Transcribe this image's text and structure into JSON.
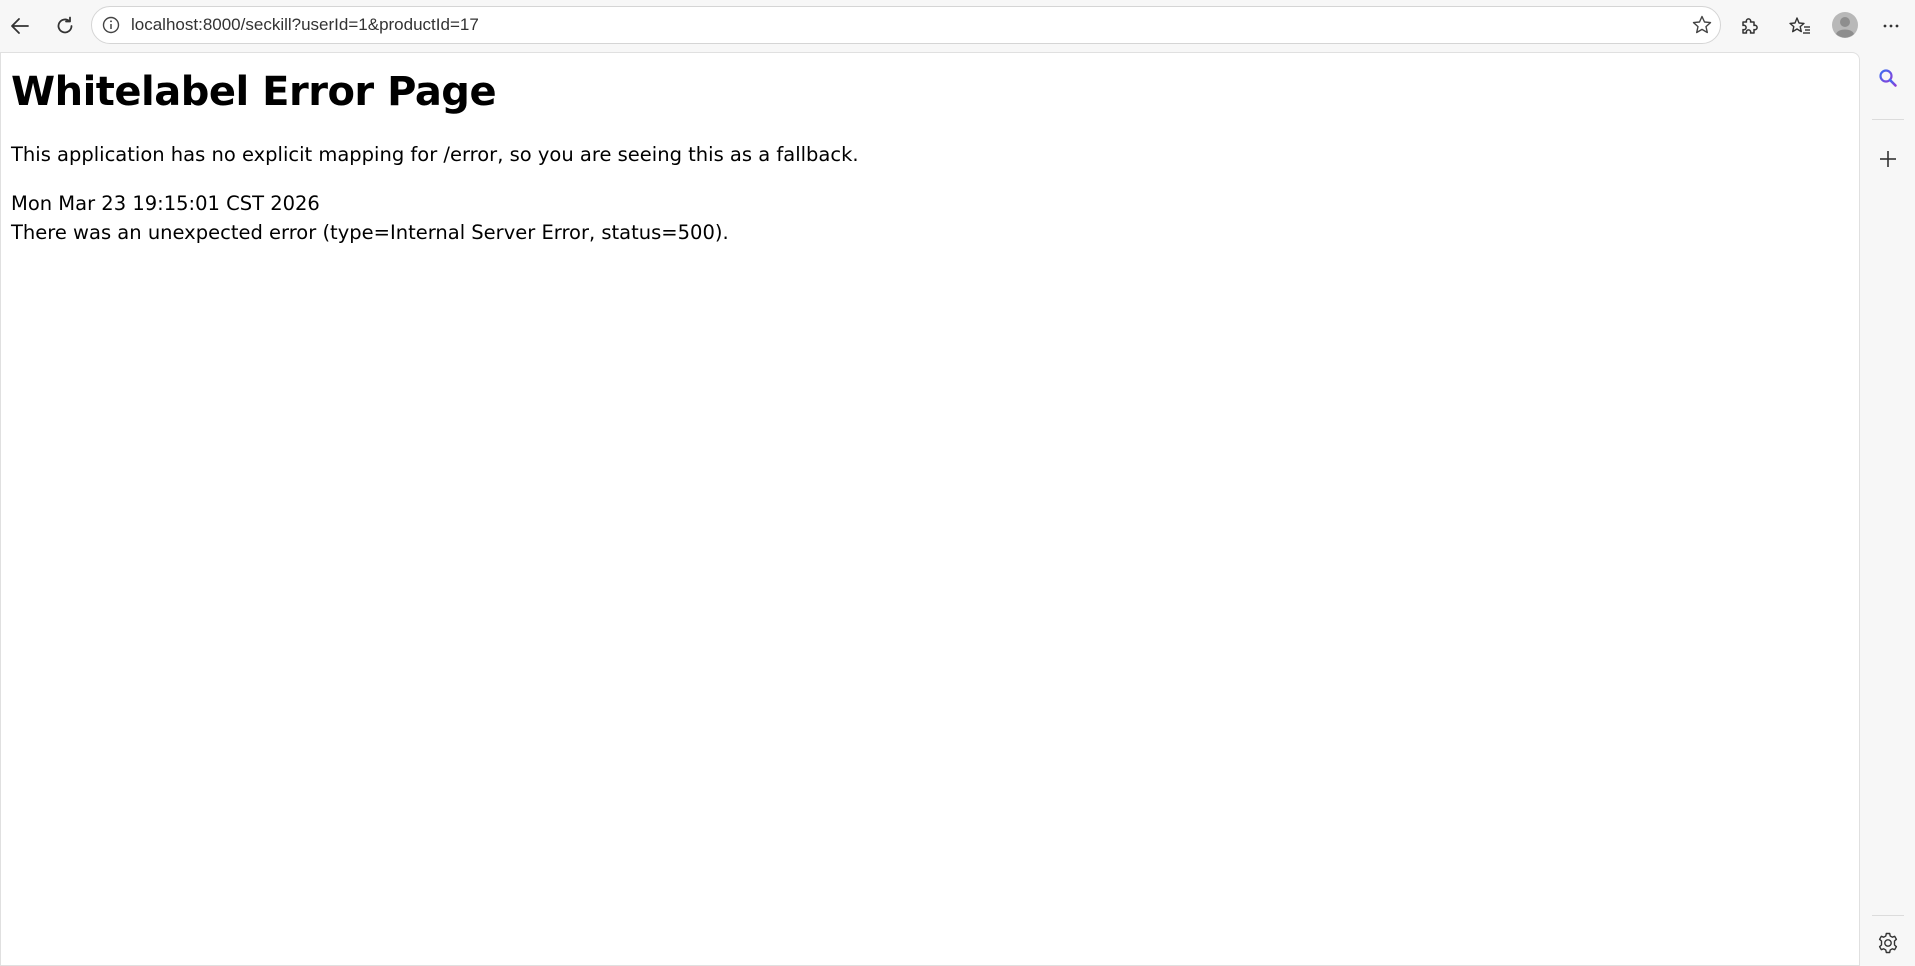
{
  "browser": {
    "url": "localhost:8000/seckill?userId=1&productId=17",
    "icons": {
      "back": "back-arrow-icon",
      "refresh": "refresh-icon",
      "site_info": "info-icon",
      "favorite": "star-icon",
      "extensions": "puzzle-icon",
      "favorites": "favorites-icon",
      "profile": "avatar",
      "menu": "more-icon",
      "search": "search-icon",
      "add": "plus-icon",
      "settings": "gear-icon"
    }
  },
  "page": {
    "title": "Whitelabel Error Page",
    "description": "This application has no explicit mapping for /error, so you are seeing this as a fallback.",
    "timestamp": "Mon Mar 23 19:15:01 CST 2026",
    "error_message": "There was an unexpected error (type=Internal Server Error, status=500)."
  }
}
